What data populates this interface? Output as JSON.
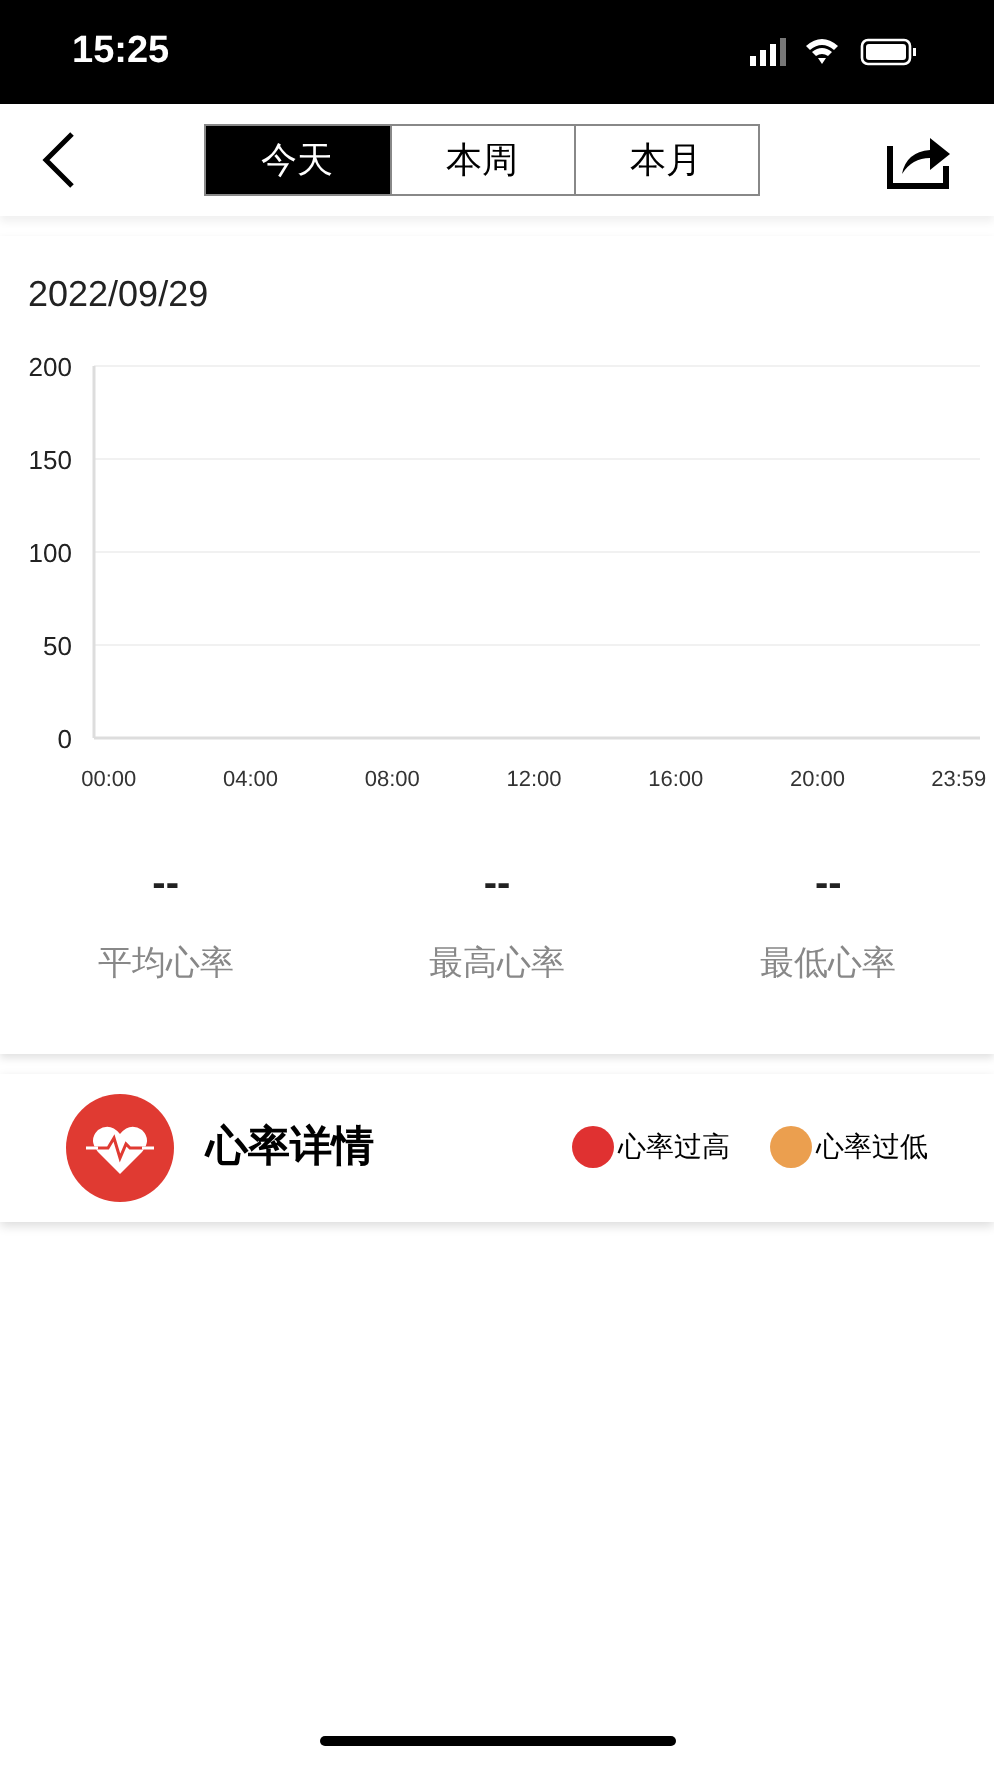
{
  "status_bar": {
    "time": "15:25"
  },
  "tabs": [
    {
      "label": "今天",
      "selected": true
    },
    {
      "label": "本周",
      "selected": false
    },
    {
      "label": "本月",
      "selected": false
    }
  ],
  "date": "2022/09/29",
  "chart": {
    "chart_data": {
      "type": "line",
      "grid": true,
      "ylim": [
        0,
        200
      ],
      "yticks": [
        0,
        50,
        100,
        150,
        200
      ],
      "xlim": [
        -25,
        1475
      ],
      "xticks": [
        {
          "value": 0,
          "label": "00:00"
        },
        {
          "value": 240,
          "label": "04:00"
        },
        {
          "value": 480,
          "label": "08:00"
        },
        {
          "value": 720,
          "label": "12:00"
        },
        {
          "value": 960,
          "label": "16:00"
        },
        {
          "value": 1200,
          "label": "20:00"
        },
        {
          "value": 1439,
          "label": "23:59"
        }
      ]
    }
  },
  "stats": [
    {
      "value": "--",
      "label": "平均心率"
    },
    {
      "value": "--",
      "label": "最高心率"
    },
    {
      "value": "--",
      "label": "最低心率"
    }
  ],
  "details": {
    "title": "心率详情",
    "legend": [
      {
        "label": "心率过高",
        "color": "#e03131"
      },
      {
        "label": "心率过低",
        "color": "#eb9f4f"
      }
    ]
  }
}
